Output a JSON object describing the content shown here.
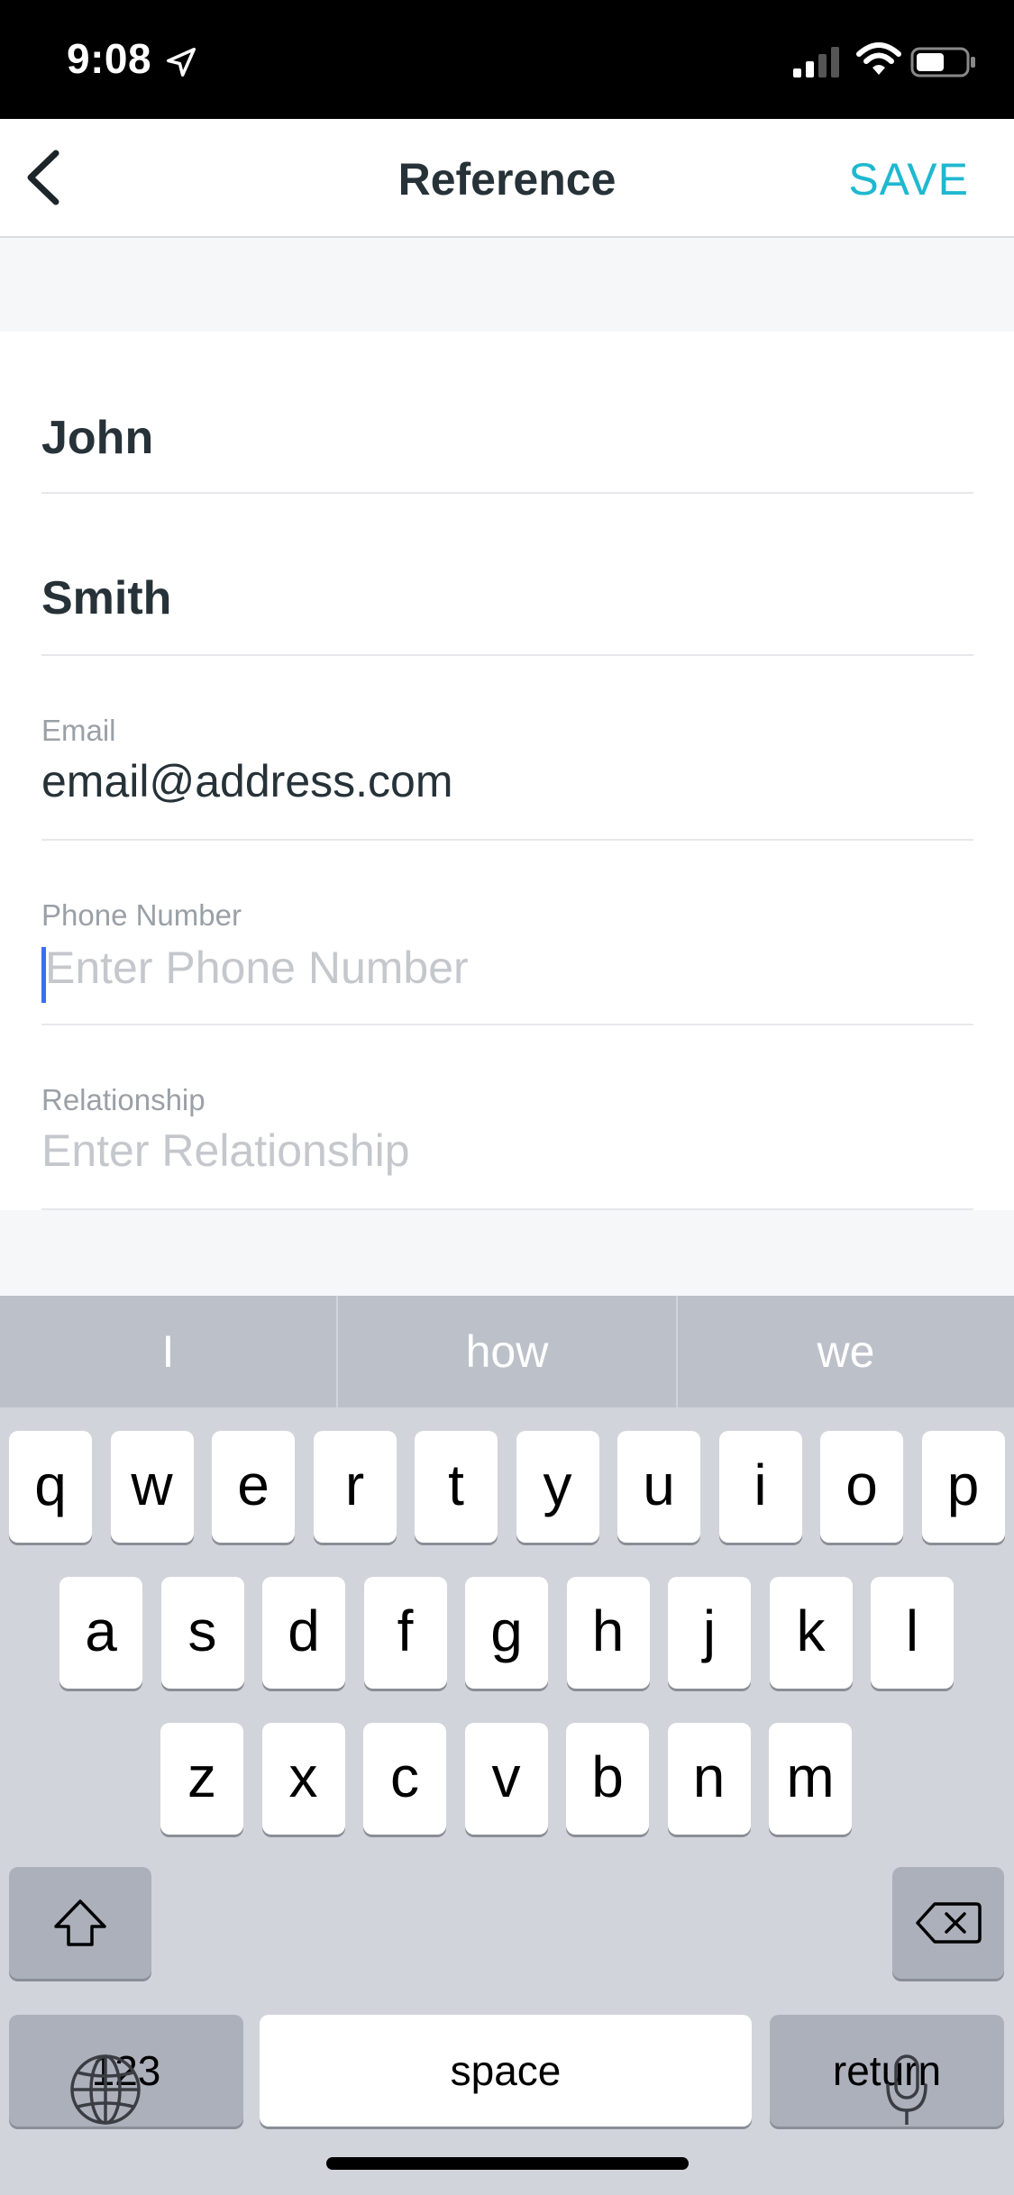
{
  "status_bar": {
    "time": "9:08"
  },
  "header": {
    "title": "Reference",
    "save_label": "SAVE"
  },
  "form": {
    "first_name": "John",
    "last_name": "Smith",
    "email_label": "Email",
    "email_value": "email@address.com",
    "phone_label": "Phone Number",
    "phone_placeholder": "Enter Phone Number",
    "relationship_label": "Relationship",
    "relationship_placeholder": "Enter Relationship"
  },
  "keyboard": {
    "suggestions": [
      "I",
      "how",
      "we"
    ],
    "row1": [
      "q",
      "w",
      "e",
      "r",
      "t",
      "y",
      "u",
      "i",
      "o",
      "p"
    ],
    "row2": [
      "a",
      "s",
      "d",
      "f",
      "g",
      "h",
      "j",
      "k",
      "l"
    ],
    "row3": [
      "z",
      "x",
      "c",
      "v",
      "b",
      "n",
      "m"
    ],
    "numbers_label": "123",
    "space_label": "space",
    "return_label": "return"
  },
  "colors": {
    "accent": "#1fb8d0",
    "cursor": "#3d6df2",
    "keyboard_bg": "#d1d4da"
  }
}
